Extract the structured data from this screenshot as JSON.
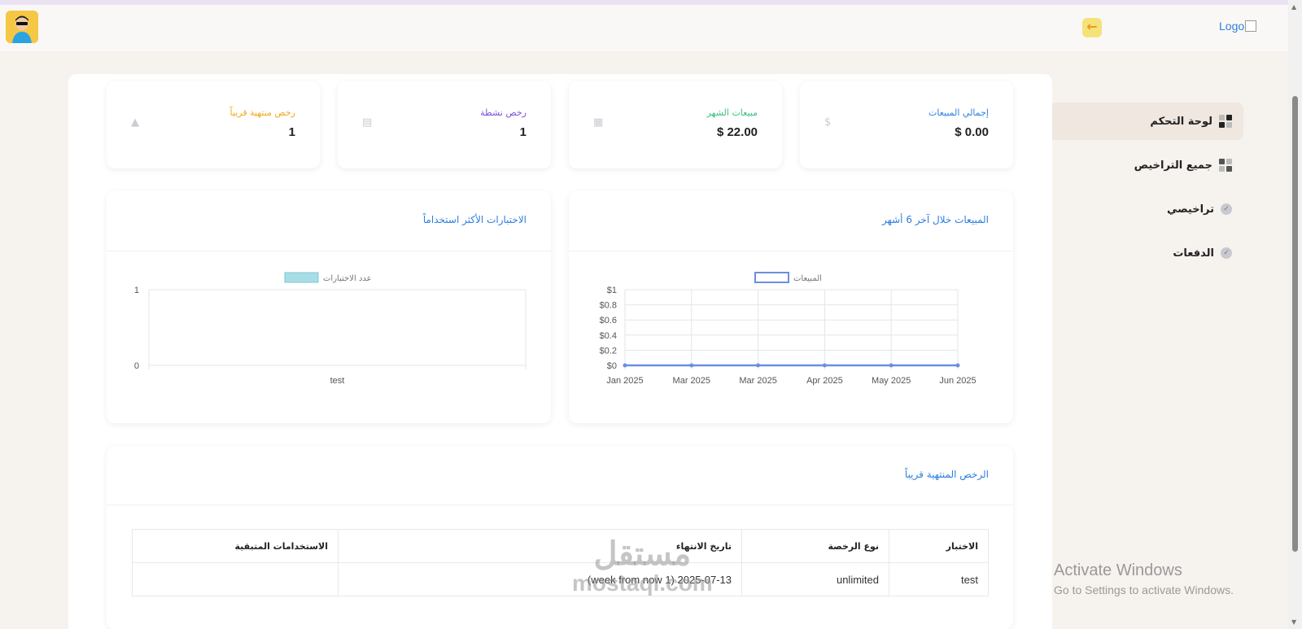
{
  "header": {
    "logo_text": "Logo",
    "logout_icon": "arrow-left-icon",
    "avatar_icon": "user-avatar"
  },
  "sidebar": {
    "items": [
      {
        "label": "لوحة التحكم",
        "icon": "grid-icon",
        "active": true
      },
      {
        "label": "جميع التراخيص",
        "icon": "grid-icon",
        "active": false
      },
      {
        "label": "تراخيصي",
        "icon": "shield-check-icon",
        "active": false
      },
      {
        "label": "الدفعات",
        "icon": "shield-check-icon",
        "active": false
      }
    ]
  },
  "stats": [
    {
      "title": "إجمالي المبيعات",
      "value": "$ 0.00",
      "color": "#2d7fe0",
      "icon": "dollar-icon"
    },
    {
      "title": "مبيعات الشهر",
      "value": "$ 22.00",
      "color": "#3bbf7a",
      "icon": "calendar-icon"
    },
    {
      "title": "رخص نشطة",
      "value": "1",
      "color": "#7b4fd6",
      "icon": "clipboard-icon"
    },
    {
      "title": "رخص منتهية قريباً",
      "value": "1",
      "color": "#f0a81a",
      "icon": "warning-icon"
    }
  ],
  "sales_chart": {
    "title": "المبيعات خلال آخر 6 أشهر",
    "chart_data": {
      "type": "line",
      "x": [
        "Jan 2025",
        "Mar 2025",
        "Mar 2025",
        "Apr 2025",
        "May 2025",
        "Jun 2025"
      ],
      "series": [
        {
          "name": "المبيعات",
          "values": [
            0,
            0,
            0,
            0,
            0,
            0
          ]
        }
      ],
      "yticks": [
        "$0",
        "$0.2",
        "$0.4",
        "$0.6",
        "$0.8",
        "$1"
      ],
      "ylim": [
        0,
        1
      ],
      "grid": true,
      "legend": "top",
      "color": "#6b8fe0"
    }
  },
  "tests_chart": {
    "title": "الاختبارات الأكثر استخداماً",
    "chart_data": {
      "type": "bar",
      "categories": [
        "test"
      ],
      "series": [
        {
          "name": "عدد الاختبارات",
          "values": [
            0
          ]
        }
      ],
      "yticks": [
        "0",
        "1"
      ],
      "ylim": [
        0,
        1
      ],
      "legend": "top",
      "color": "#a8dde6"
    }
  },
  "expiring_table": {
    "title": "الرخص المنتهية قريباً",
    "columns": [
      "الاختبار",
      "نوع الرخصة",
      "تاريخ الانتهاء",
      "الاستخدامات المتبقية"
    ],
    "rows": [
      [
        "test",
        "unlimited",
        "2025-07-13 (1 week from now)",
        ""
      ]
    ]
  },
  "watermark": {
    "arabic": "مستقل",
    "latin": "mostaql.com"
  },
  "os_notice": {
    "line1": "Activate Windows",
    "line2": "Go to Settings to activate Windows."
  }
}
